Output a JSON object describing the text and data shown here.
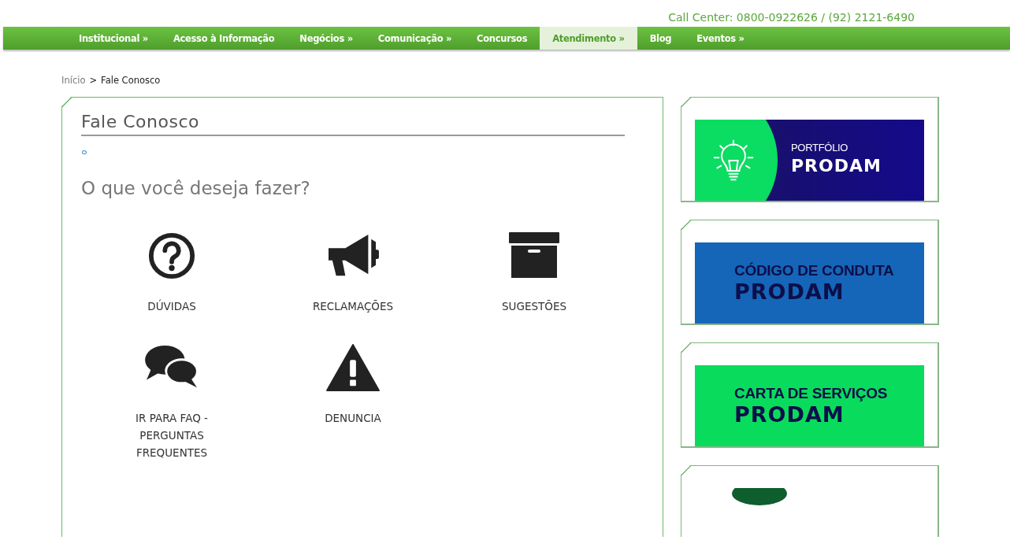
{
  "header": {
    "call_center": "Call Center: 0800-0922626 / (92) 2121-6490"
  },
  "nav": [
    {
      "label": "Institucional »",
      "selected": false
    },
    {
      "label": "Acesso à Informação",
      "selected": false
    },
    {
      "label": "Negócios »",
      "selected": false
    },
    {
      "label": "Comunicação »",
      "selected": false
    },
    {
      "label": "Concursos",
      "selected": false
    },
    {
      "label": "Atendimento »",
      "selected": true
    },
    {
      "label": "Blog",
      "selected": false
    },
    {
      "label": "Eventos »",
      "selected": false
    }
  ],
  "breadcrumb": {
    "items": [
      "Início",
      "Fale Conosco"
    ],
    "separator": ">"
  },
  "panel": {
    "title": "Fale Conosco",
    "question": "O que você deseja fazer?",
    "options": [
      {
        "kind": "question",
        "label": "DÚVIDAS"
      },
      {
        "kind": "megaphone",
        "label": "RECLAMAÇÕES"
      },
      {
        "kind": "box",
        "label": "SUGESTÕES"
      },
      {
        "kind": "chat",
        "label": "IR PARA FAQ - PERGUNTAS FREQUENTES"
      },
      {
        "kind": "warning",
        "label": "DENUNCIA"
      }
    ]
  },
  "sidebar": [
    {
      "kind": "portfolio",
      "caption": "PORTFÓLIO",
      "brand": "PRODAM"
    },
    {
      "kind": "code",
      "caption": "CÓDIGO DE CONDUTA",
      "brand": "PRODAM"
    },
    {
      "kind": "services",
      "caption": "CARTA DE SERVIÇOS",
      "brand": "PRODAM"
    },
    {
      "kind": "partial"
    }
  ]
}
